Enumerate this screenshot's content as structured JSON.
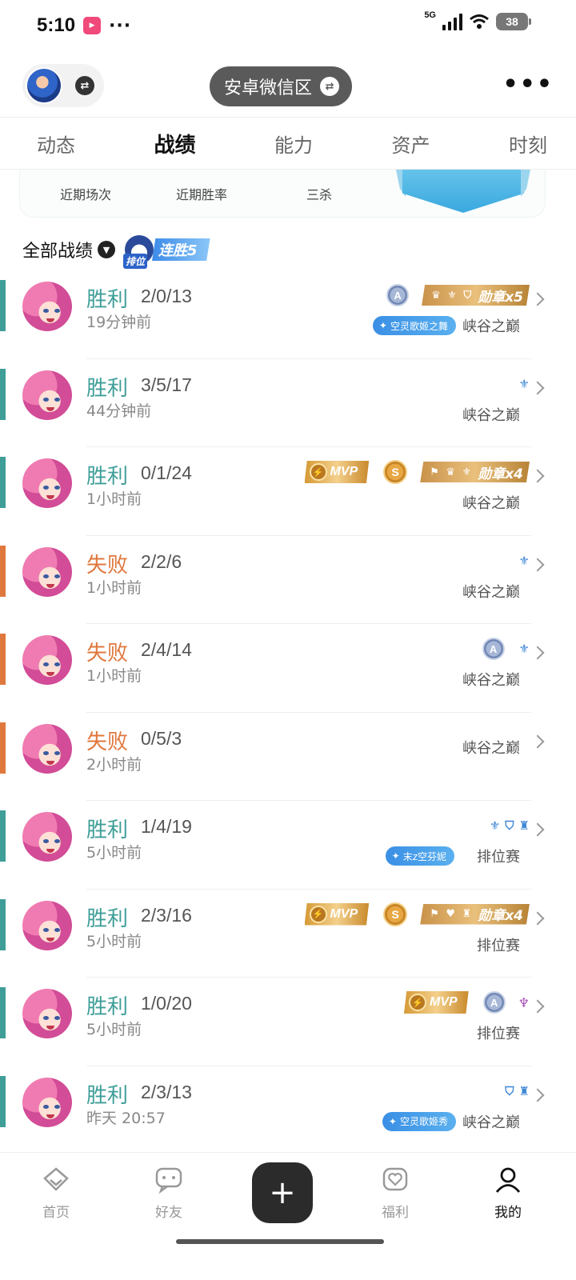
{
  "status": {
    "time": "5:10",
    "app_icon": "bilibili-icon",
    "dots": "···",
    "network": "5G",
    "battery": "38"
  },
  "header": {
    "server": "安卓微信区",
    "swap_glyph": "⇄",
    "more": "•••"
  },
  "tabs": [
    {
      "label": "动态"
    },
    {
      "label": "战绩"
    },
    {
      "label": "能力"
    },
    {
      "label": "资产"
    },
    {
      "label": "时刻"
    }
  ],
  "active_tab": "战绩",
  "summary": {
    "labels": [
      "近期场次",
      "近期胜率",
      "三杀"
    ]
  },
  "filter": {
    "label": "全部战绩",
    "streak_rank": "排位",
    "streak_text": "连胜5"
  },
  "matches": [
    {
      "result": "胜利",
      "kda": "2/0/13",
      "time": "19分钟前",
      "mode": "峡谷之巅",
      "medal_count": "勋章x5",
      "skin": "空灵歌姬之舞"
    },
    {
      "result": "胜利",
      "kda": "3/5/17",
      "time": "44分钟前",
      "mode": "峡谷之巅"
    },
    {
      "result": "胜利",
      "kda": "0/1/24",
      "time": "1小时前",
      "mode": "峡谷之巅",
      "mvp": "MVP",
      "s_badge": "S",
      "medal_count": "勋章x4"
    },
    {
      "result": "失败",
      "kda": "2/2/6",
      "time": "1小时前",
      "mode": "峡谷之巅"
    },
    {
      "result": "失败",
      "kda": "2/4/14",
      "time": "1小时前",
      "mode": "峡谷之巅",
      "a_badge": "A"
    },
    {
      "result": "失败",
      "kda": "0/5/3",
      "time": "2小时前",
      "mode": "峡谷之巅"
    },
    {
      "result": "胜利",
      "kda": "1/4/19",
      "time": "5小时前",
      "mode": "排位赛",
      "skin": "末z空芬妮"
    },
    {
      "result": "胜利",
      "kda": "2/3/16",
      "time": "5小时前",
      "mode": "排位赛",
      "mvp": "MVP",
      "s_badge": "S",
      "medal_count": "勋章x4"
    },
    {
      "result": "胜利",
      "kda": "1/0/20",
      "time": "5小时前",
      "mode": "排位赛",
      "mvp": "MVP",
      "a_badge": "A"
    },
    {
      "result": "胜利",
      "kda": "2/3/13",
      "time": "昨天 20:57",
      "mode": "峡谷之巅",
      "skin": "空灵歌姬秀"
    }
  ],
  "first_a_badge": "A",
  "colors": {
    "win": "#3f9e98",
    "loss": "#e0773c",
    "medal_gold": "#c9924a",
    "skin_blue": "#3a8fe5"
  },
  "bottom_nav": [
    {
      "label": "首页"
    },
    {
      "label": "好友"
    },
    {
      "label": "福利"
    },
    {
      "label": "我的"
    }
  ],
  "center_button": "+"
}
